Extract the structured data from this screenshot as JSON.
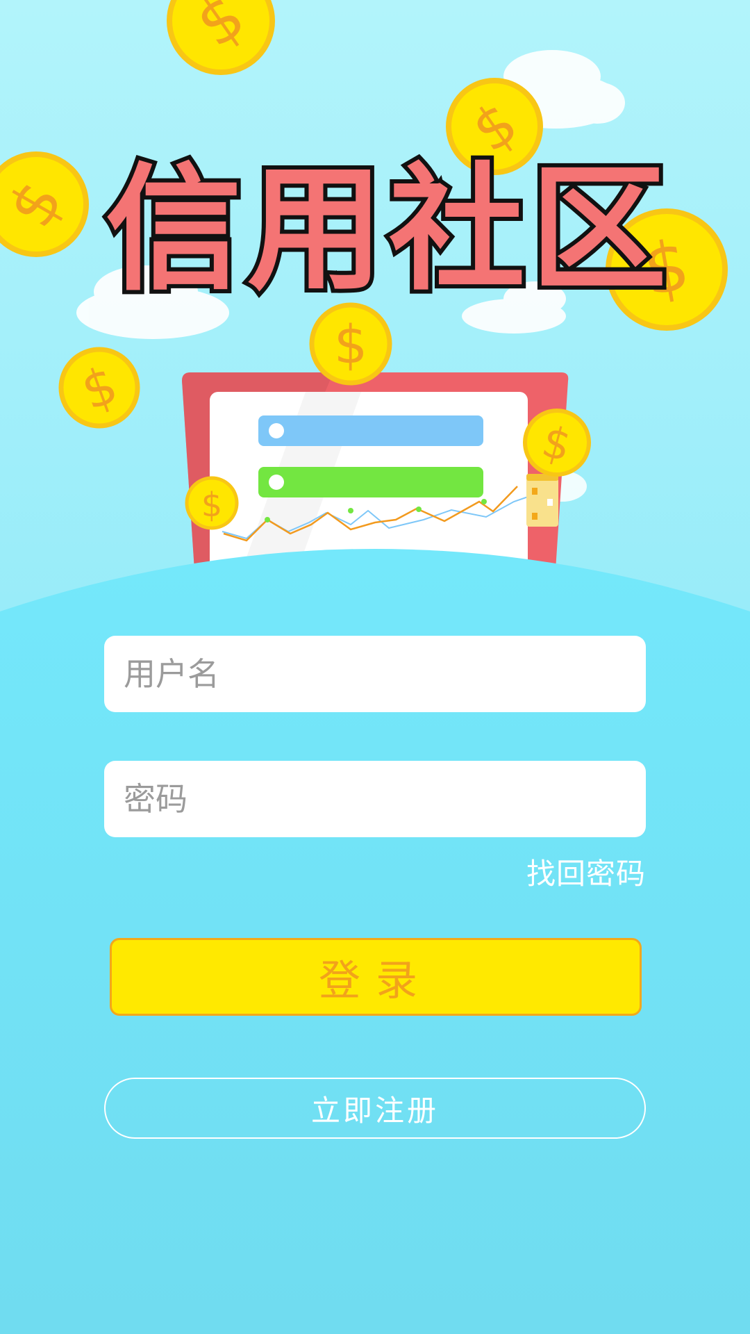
{
  "app": {
    "title": "信用社区"
  },
  "login_form": {
    "username_placeholder": "用户名",
    "password_placeholder": "密码",
    "forgot_password": "找回密码",
    "login_label": "登录",
    "register_label": "立即注册"
  },
  "theme": {
    "sky": "#b2f4fb",
    "body": "#6fdcf0",
    "title_fill": "#f47474",
    "coin": "#ffe600",
    "login_button": "#ffe900",
    "login_text": "#f2a21b"
  },
  "illustration": {
    "coin_symbol": "$"
  }
}
